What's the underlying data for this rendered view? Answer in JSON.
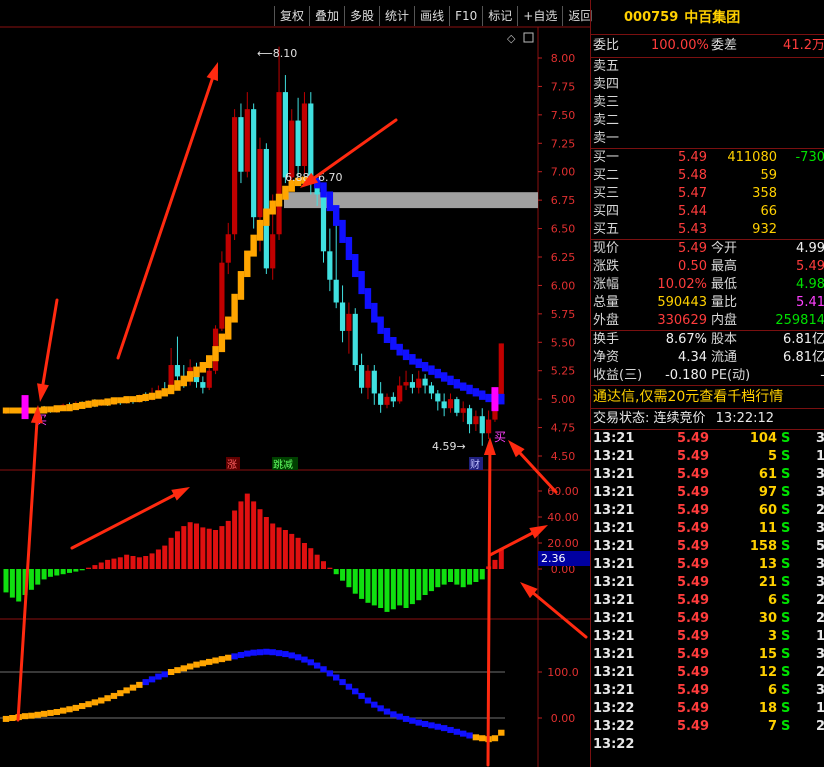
{
  "toolbar": {
    "items": [
      "复权",
      "叠加",
      "多股",
      "统计",
      "画线",
      "F10",
      "标记",
      "+自选",
      "返回"
    ]
  },
  "stock": {
    "code": "000759",
    "name": "中百集团"
  },
  "weibi": {
    "label1": "委比",
    "value1": "100.00%",
    "label2": "委差",
    "value2": "41.2万"
  },
  "asks": [
    {
      "label": "卖五"
    },
    {
      "label": "卖四"
    },
    {
      "label": "卖三"
    },
    {
      "label": "卖二"
    },
    {
      "label": "卖一"
    }
  ],
  "bids": [
    {
      "label": "买一",
      "price": "5.49",
      "vol": "411080",
      "chg": "-730"
    },
    {
      "label": "买二",
      "price": "5.48",
      "vol": "59",
      "chg": ""
    },
    {
      "label": "买三",
      "price": "5.47",
      "vol": "358",
      "chg": ""
    },
    {
      "label": "买四",
      "price": "5.44",
      "vol": "66",
      "chg": ""
    },
    {
      "label": "买五",
      "price": "5.43",
      "vol": "932",
      "chg": ""
    }
  ],
  "quote": [
    {
      "l1": "现价",
      "v1": "5.49",
      "c1": "red",
      "l2": "今开",
      "v2": "4.99",
      "c2": "wht"
    },
    {
      "l1": "涨跌",
      "v1": "0.50",
      "c1": "red",
      "l2": "最高",
      "v2": "5.49",
      "c2": "red"
    },
    {
      "l1": "涨幅",
      "v1": "10.02%",
      "c1": "red",
      "l2": "最低",
      "v2": "4.98",
      "c2": "grn"
    },
    {
      "l1": "总量",
      "v1": "590443",
      "c1": "yel",
      "l2": "量比",
      "v2": "5.41",
      "c2": "mag"
    },
    {
      "l1": "外盘",
      "v1": "330629",
      "c1": "red",
      "l2": "内盘",
      "v2": "259814",
      "c2": "grn"
    }
  ],
  "fund": [
    {
      "l1": "换手",
      "v1": "8.67%",
      "l2": "股本",
      "v2": "6.81亿"
    },
    {
      "l1": "净资",
      "v1": "4.34",
      "l2": "流通",
      "v2": "6.81亿"
    },
    {
      "l1": "收益(三)",
      "v1": "-0.180",
      "l2": "PE(动)",
      "v2": "-"
    }
  ],
  "promo": "通达信,仅需20元查看千档行情",
  "state": {
    "label": "交易状态: 连续竞价",
    "time": "13:22:12"
  },
  "ticks": [
    {
      "t": "13:21",
      "p": "5.49",
      "q": "104",
      "s": "S",
      "n": "3"
    },
    {
      "t": "13:21",
      "p": "5.49",
      "q": "5",
      "s": "S",
      "n": "1"
    },
    {
      "t": "13:21",
      "p": "5.49",
      "q": "61",
      "s": "S",
      "n": "3"
    },
    {
      "t": "13:21",
      "p": "5.49",
      "q": "97",
      "s": "S",
      "n": "3"
    },
    {
      "t": "13:21",
      "p": "5.49",
      "q": "60",
      "s": "S",
      "n": "2"
    },
    {
      "t": "13:21",
      "p": "5.49",
      "q": "11",
      "s": "S",
      "n": "3"
    },
    {
      "t": "13:21",
      "p": "5.49",
      "q": "158",
      "s": "S",
      "n": "5"
    },
    {
      "t": "13:21",
      "p": "5.49",
      "q": "13",
      "s": "S",
      "n": "3"
    },
    {
      "t": "13:21",
      "p": "5.49",
      "q": "21",
      "s": "S",
      "n": "3"
    },
    {
      "t": "13:21",
      "p": "5.49",
      "q": "6",
      "s": "S",
      "n": "2"
    },
    {
      "t": "13:21",
      "p": "5.49",
      "q": "30",
      "s": "S",
      "n": "2"
    },
    {
      "t": "13:21",
      "p": "5.49",
      "q": "3",
      "s": "S",
      "n": "1"
    },
    {
      "t": "13:21",
      "p": "5.49",
      "q": "15",
      "s": "S",
      "n": "3"
    },
    {
      "t": "13:21",
      "p": "5.49",
      "q": "12",
      "s": "S",
      "n": "2"
    },
    {
      "t": "13:21",
      "p": "5.49",
      "q": "6",
      "s": "S",
      "n": "3"
    },
    {
      "t": "13:22",
      "p": "5.49",
      "q": "18",
      "s": "S",
      "n": "1"
    },
    {
      "t": "13:22",
      "p": "5.49",
      "q": "7",
      "s": "S",
      "n": "2"
    },
    {
      "t": "13:22",
      "p": "",
      "q": "",
      "s": "",
      "n": ""
    }
  ],
  "chart_data": [
    {
      "type": "candlestick",
      "y_ticks": [
        "8.00",
        "7.75",
        "7.50",
        "7.25",
        "7.00",
        "6.75",
        "6.50",
        "6.25",
        "6.00",
        "5.75",
        "5.50",
        "5.25",
        "5.00",
        "4.75",
        "4.50"
      ],
      "ylim": [
        4.45,
        8.1
      ],
      "annotations": [
        "8.10",
        "6.88",
        "6.70",
        "4.59",
        "买",
        "买",
        "涨",
        "跳减",
        "财"
      ],
      "colors": {
        "up": "#ff2020",
        "down": "#40e0e0",
        "line_up": "#ffa500",
        "line_down": "#1010ff",
        "zone": "#a0a0a0"
      },
      "candles": [
        [
          4.88,
          4.9,
          4.87,
          4.91
        ],
        [
          4.9,
          4.89,
          4.88,
          4.91
        ],
        [
          4.89,
          4.9,
          4.88,
          4.92
        ],
        [
          4.9,
          4.91,
          4.89,
          4.93
        ],
        [
          4.91,
          4.9,
          4.89,
          4.92
        ],
        [
          4.9,
          4.92,
          4.89,
          4.93
        ],
        [
          4.92,
          4.91,
          4.9,
          4.94
        ],
        [
          4.91,
          4.89,
          4.88,
          4.92
        ],
        [
          4.89,
          4.92,
          4.88,
          4.93
        ],
        [
          4.92,
          4.95,
          4.91,
          4.96
        ],
        [
          4.95,
          4.93,
          4.92,
          4.97
        ],
        [
          4.93,
          4.96,
          4.92,
          4.98
        ],
        [
          4.96,
          4.94,
          4.92,
          4.98
        ],
        [
          4.94,
          4.97,
          4.93,
          4.99
        ],
        [
          4.97,
          4.95,
          4.93,
          5.0
        ],
        [
          4.95,
          4.98,
          4.94,
          5.0
        ],
        [
          4.98,
          4.96,
          4.94,
          5.0
        ],
        [
          4.96,
          4.99,
          4.95,
          5.01
        ],
        [
          4.99,
          4.97,
          4.95,
          5.01
        ],
        [
          4.97,
          5.0,
          4.96,
          5.02
        ],
        [
          5.0,
          4.98,
          4.96,
          5.02
        ],
        [
          4.98,
          5.02,
          4.97,
          5.04
        ],
        [
          5.02,
          5.0,
          4.98,
          5.06
        ],
        [
          5.0,
          5.05,
          4.99,
          5.1
        ],
        [
          5.05,
          5.08,
          5.03,
          5.12
        ],
        [
          5.08,
          5.06,
          5.04,
          5.15
        ],
        [
          5.06,
          5.3,
          5.05,
          5.45
        ],
        [
          5.3,
          5.2,
          5.15,
          5.55
        ],
        [
          5.2,
          5.18,
          5.1,
          5.3
        ],
        [
          5.18,
          5.28,
          5.12,
          5.35
        ],
        [
          5.28,
          5.15,
          5.1,
          5.32
        ],
        [
          5.15,
          5.1,
          5.05,
          5.2
        ],
        [
          5.1,
          5.25,
          5.08,
          5.28
        ],
        [
          5.25,
          5.62,
          5.22,
          5.65
        ],
        [
          5.62,
          6.2,
          5.6,
          6.3
        ],
        [
          6.2,
          6.45,
          6.1,
          6.55
        ],
        [
          6.45,
          7.48,
          6.4,
          7.55
        ],
        [
          7.48,
          7.0,
          6.9,
          7.6
        ],
        [
          7.0,
          7.55,
          6.95,
          7.7
        ],
        [
          7.55,
          6.6,
          6.5,
          7.6
        ],
        [
          6.6,
          7.2,
          6.3,
          7.3
        ],
        [
          7.2,
          6.15,
          6.1,
          7.25
        ],
        [
          6.15,
          6.45,
          6.05,
          6.8
        ],
        [
          6.45,
          7.7,
          6.4,
          8.1
        ],
        [
          7.7,
          6.95,
          6.9,
          7.85
        ],
        [
          6.95,
          7.45,
          6.85,
          7.55
        ],
        [
          7.45,
          7.05,
          6.95,
          7.65
        ],
        [
          7.05,
          7.6,
          6.98,
          7.7
        ],
        [
          7.6,
          6.9,
          6.8,
          7.7
        ],
        [
          6.9,
          6.8,
          6.7,
          6.88
        ],
        [
          6.8,
          6.3,
          6.2,
          6.85
        ],
        [
          6.3,
          6.05,
          5.95,
          6.5
        ],
        [
          6.05,
          5.85,
          5.8,
          6.55
        ],
        [
          5.85,
          5.6,
          5.5,
          6.0
        ],
        [
          5.6,
          5.75,
          5.4,
          5.85
        ],
        [
          5.75,
          5.3,
          5.25,
          5.8
        ],
        [
          5.3,
          5.1,
          5.05,
          5.4
        ],
        [
          5.1,
          5.25,
          5.0,
          5.3
        ],
        [
          5.25,
          5.05,
          4.95,
          5.3
        ],
        [
          5.05,
          4.95,
          4.88,
          5.15
        ],
        [
          4.95,
          5.02,
          4.92,
          5.05
        ],
        [
          5.02,
          4.98,
          4.93,
          5.06
        ],
        [
          4.98,
          5.12,
          4.96,
          5.2
        ],
        [
          5.12,
          5.15,
          5.08,
          5.25
        ],
        [
          5.15,
          5.1,
          5.05,
          5.22
        ],
        [
          5.1,
          5.18,
          5.05,
          5.25
        ],
        [
          5.18,
          5.12,
          5.05,
          5.22
        ],
        [
          5.12,
          5.05,
          5.0,
          5.15
        ],
        [
          5.05,
          4.98,
          4.9,
          5.08
        ],
        [
          4.98,
          4.92,
          4.85,
          5.05
        ],
        [
          4.92,
          5.0,
          4.88,
          5.05
        ],
        [
          5.0,
          4.88,
          4.85,
          5.02
        ],
        [
          4.88,
          4.92,
          4.8,
          4.98
        ],
        [
          4.92,
          4.78,
          4.7,
          4.95
        ],
        [
          4.78,
          4.85,
          4.72,
          4.9
        ],
        [
          4.85,
          4.7,
          4.59,
          4.92
        ],
        [
          4.7,
          4.82,
          4.65,
          4.9
        ],
        [
          4.82,
          4.99,
          4.8,
          5.0
        ],
        [
          4.99,
          5.49,
          4.98,
          5.49
        ]
      ],
      "trend_line": [
        4.9,
        4.9,
        4.9,
        4.9,
        4.9,
        4.9,
        4.91,
        4.91,
        4.92,
        4.92,
        4.93,
        4.94,
        4.95,
        4.96,
        4.97,
        4.97,
        4.98,
        4.99,
        4.99,
        5.0,
        5.0,
        5.01,
        5.02,
        5.03,
        5.05,
        5.07,
        5.1,
        5.14,
        5.18,
        5.22,
        5.26,
        5.3,
        5.36,
        5.44,
        5.55,
        5.7,
        5.9,
        6.1,
        6.28,
        6.42,
        6.55,
        6.65,
        6.72,
        6.78,
        6.85,
        6.9,
        6.92,
        6.93,
        6.92,
        6.88,
        6.8,
        6.68,
        6.55,
        6.4,
        6.25,
        6.1,
        5.95,
        5.82,
        5.7,
        5.6,
        5.52,
        5.46,
        5.41,
        5.37,
        5.33,
        5.3,
        5.27,
        5.24,
        5.21,
        5.18,
        5.15,
        5.12,
        5.1,
        5.07,
        5.05,
        5.02,
        5.0,
        4.98,
        5.02
      ],
      "trend_down_from": 48,
      "zone": [
        6.82,
        6.68
      ],
      "buy_marks": [
        3,
        77
      ]
    },
    {
      "type": "bar",
      "name": "macd",
      "y_ticks": [
        "60.00",
        "40.00",
        "20.00",
        "0.00"
      ],
      "ylim": [
        -40,
        62
      ],
      "last_label": "2.36",
      "values": [
        -18,
        -22,
        -25,
        -20,
        -16,
        -12,
        -8,
        -6,
        -5,
        -4,
        -3,
        -2,
        -1,
        1,
        3,
        5,
        7,
        8,
        9,
        11,
        10,
        9,
        10,
        12,
        15,
        18,
        24,
        29,
        33,
        36,
        35,
        32,
        31,
        30,
        33,
        37,
        45,
        52,
        58,
        52,
        46,
        40,
        35,
        32,
        30,
        27,
        24,
        20,
        16,
        11,
        6,
        1,
        -4,
        -9,
        -14,
        -19,
        -23,
        -26,
        -28,
        -30,
        -33,
        -31,
        -28,
        -30,
        -27,
        -24,
        -20,
        -17,
        -14,
        -12,
        -10,
        -12,
        -14,
        -12,
        -10,
        -8,
        2,
        7,
        15
      ]
    },
    {
      "type": "line",
      "name": "trend",
      "y_ticks": [
        "100.0",
        "0.00"
      ],
      "ylim": [
        -60,
        170
      ],
      "values": [
        -2,
        0,
        2,
        4,
        5,
        7,
        9,
        11,
        13,
        16,
        19,
        22,
        26,
        30,
        34,
        38,
        43,
        48,
        54,
        60,
        66,
        72,
        78,
        84,
        90,
        95,
        100,
        104,
        108,
        112,
        116,
        119,
        122,
        125,
        128,
        131,
        134,
        137,
        140,
        142,
        143,
        144,
        143,
        141,
        139,
        136,
        132,
        127,
        121,
        114,
        106,
        97,
        88,
        78,
        68,
        58,
        48,
        38,
        29,
        21,
        14,
        8,
        3,
        -2,
        -6,
        -10,
        -13,
        -16,
        -19,
        -22,
        -26,
        -30,
        -34,
        -38,
        -42,
        -44,
        -46,
        -44,
        -32
      ],
      "down_ranges": [
        [
          22,
          25
        ],
        [
          36,
          73
        ]
      ]
    }
  ]
}
